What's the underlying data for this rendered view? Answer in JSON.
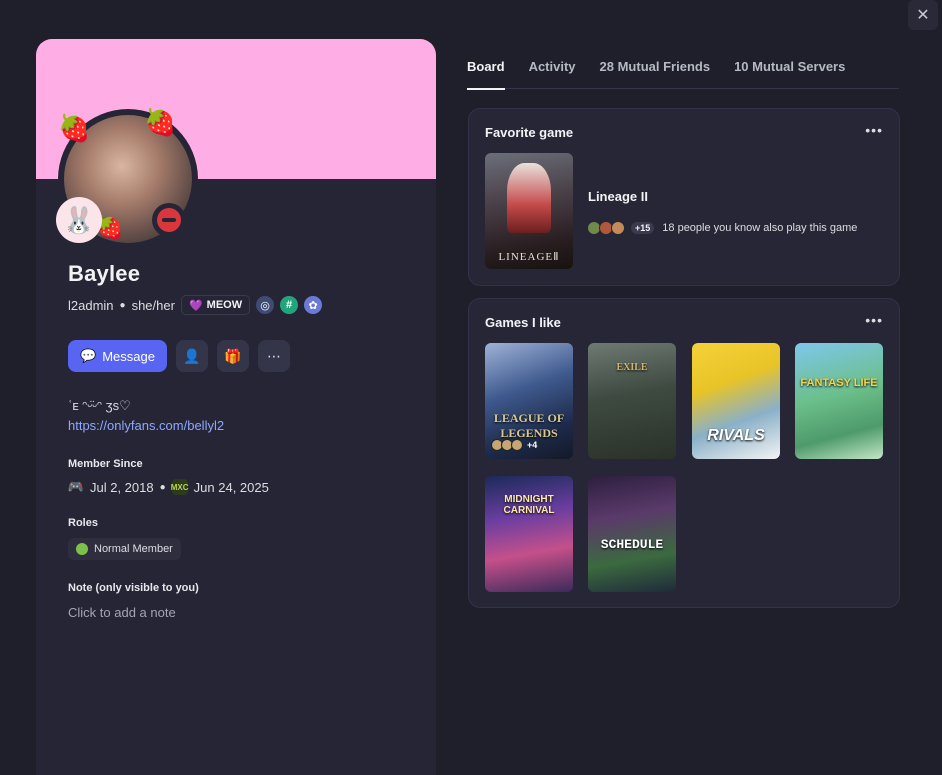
{
  "close": {
    "label": "✕"
  },
  "profile": {
    "display_name": "Baylee",
    "username": "l2admin",
    "pronouns": "she/her",
    "tag": "MEOW",
    "tag_icon": "💜",
    "badges": [
      "nitro-badge-icon",
      "hashtag-badge-icon",
      "boost-badge-icon"
    ],
    "actions": {
      "message_label": "Message"
    },
    "bio_line1": "ʿᴇ ᵔᵕ̈ᵕᵔ ʒs♡",
    "bio_link": "https://onlyfans.com/bellyl2",
    "member_since_label": "Member Since",
    "discord_since": "Jul 2, 2018",
    "server_since": "Jun 24, 2025",
    "server_icon_text": "MXC",
    "roles_label": "Roles",
    "role": "Normal Member",
    "note_label": "Note (only visible to you)",
    "note_placeholder": "Click to add a note"
  },
  "tabs": [
    {
      "label": "Board"
    },
    {
      "label": "Activity"
    },
    {
      "label": "28 Mutual Friends"
    },
    {
      "label": "10 Mutual Servers"
    }
  ],
  "favorite": {
    "title": "Favorite game",
    "more": "•••",
    "game_name": "Lineage II",
    "cover_logo": "LINEAGEⅡ",
    "plus_count": "+15",
    "friends_text": "18 people you know also play this game"
  },
  "games": {
    "title": "Games I like",
    "more": "•••",
    "items": [
      {
        "title": "LEAGUE OF LEGENDS",
        "plus": "+4"
      },
      {
        "title": "EXILE"
      },
      {
        "title": "RIVALS"
      },
      {
        "title": "FANTASY LIFE"
      },
      {
        "title": "MIDNIGHT CARNIVAL"
      },
      {
        "title": "SCHEDULE"
      }
    ]
  },
  "colors": {
    "accent": "#5865f2",
    "banner": "#ffaee5",
    "dnd": "#da373c",
    "role": "#7cc24a"
  }
}
